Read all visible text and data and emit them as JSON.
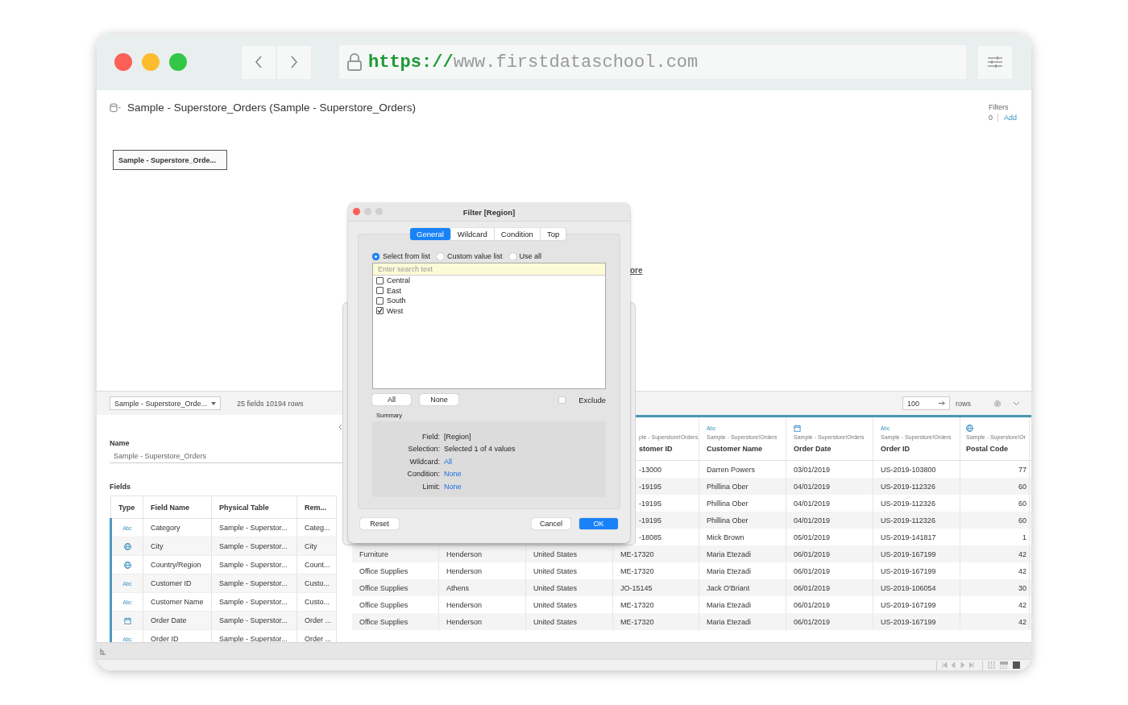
{
  "browser": {
    "url_scheme": "https://",
    "url_host": "www.firstdataschool.com"
  },
  "datasource": {
    "title": "Sample - Superstore_Orders (Sample - Superstore_Orders)",
    "filters_label": "Filters",
    "filters_count": "0",
    "filters_add": "Add",
    "table_chip": "Sample - Superstore_Orde...",
    "link_fragment": "ore"
  },
  "toolbar": {
    "table_select": "Sample - Superstore_Orde...",
    "summary": "25 fields 10194 rows",
    "rows_value": "100",
    "rows_label": "rows"
  },
  "metadata": {
    "name_label": "Name",
    "name_value": "Sample - Superstore_Orders",
    "fields_label": "Fields",
    "columns": [
      "Type",
      "Field Name",
      "Physical Table",
      "Rem..."
    ],
    "rows": [
      {
        "kind": "string",
        "icon_text": "Abc",
        "field": "Category",
        "table": "Sample - Superstor...",
        "remote": "Categ..."
      },
      {
        "kind": "geo",
        "field": "City",
        "table": "Sample - Superstor...",
        "remote": "City"
      },
      {
        "kind": "geo",
        "field": "Country/Region",
        "table": "Sample - Superstor...",
        "remote": "Count..."
      },
      {
        "kind": "string",
        "icon_text": "Abc",
        "field": "Customer ID",
        "table": "Sample - Superstor...",
        "remote": "Custo..."
      },
      {
        "kind": "string",
        "icon_text": "Abc",
        "field": "Customer Name",
        "table": "Sample - Superstor...",
        "remote": "Custo..."
      },
      {
        "kind": "date",
        "field": "Order Date",
        "table": "Sample - Superstor...",
        "remote": "Order ..."
      },
      {
        "kind": "string",
        "icon_text": "Abc",
        "field": "Order ID",
        "table": "Sample - Superstor...",
        "remote": "Order ..."
      }
    ]
  },
  "grid": {
    "columns": [
      {
        "source": "ple - Superstore!Orders",
        "name": "stomer ID"
      },
      {
        "kind": "string",
        "icon_text": "Abc",
        "source": "Sample - Superstore!Orders",
        "name": "Customer Name"
      },
      {
        "kind": "date",
        "source": "Sample - Superstore!Orders",
        "name": "Order Date"
      },
      {
        "kind": "string",
        "icon_text": "Abc",
        "source": "Sample - Superstore!Orders",
        "name": "Order ID"
      },
      {
        "kind": "geo",
        "source": "Sample - Superstore!Or",
        "name": "Postal Code"
      }
    ],
    "rows": [
      {
        "cells": [
          "-13000",
          "Darren Powers",
          "03/01/2019",
          "US-2019-103800",
          "77"
        ]
      },
      {
        "cells": [
          "-19195",
          "Phillina Ober",
          "04/01/2019",
          "US-2019-112326",
          "60"
        ]
      },
      {
        "cells": [
          "-19195",
          "Phillina Ober",
          "04/01/2019",
          "US-2019-112326",
          "60"
        ]
      },
      {
        "cells": [
          "-19195",
          "Phillina Ober",
          "04/01/2019",
          "US-2019-112326",
          "60"
        ]
      },
      {
        "cells": [
          "-18085",
          "Mick Brown",
          "05/01/2019",
          "US-2019-141817",
          "1"
        ]
      },
      {
        "cells": [
          "Furniture",
          "Henderson",
          "United States",
          "ME-17320",
          "Maria Etezadi",
          "06/01/2019",
          "US-2019-167199",
          "42"
        ]
      },
      {
        "cells": [
          "Office Supplies",
          "Henderson",
          "United States",
          "ME-17320",
          "Maria Etezadi",
          "06/01/2019",
          "US-2019-167199",
          "42"
        ]
      },
      {
        "cells": [
          "Office Supplies",
          "Athens",
          "United States",
          "JO-15145",
          "Jack O'Briant",
          "06/01/2019",
          "US-2019-106054",
          "30"
        ]
      },
      {
        "cells": [
          "Office Supplies",
          "Henderson",
          "United States",
          "ME-17320",
          "Maria Etezadi",
          "06/01/2019",
          "US-2019-167199",
          "42"
        ]
      },
      {
        "cells": [
          "Office Supplies",
          "Henderson",
          "United States",
          "ME-17320",
          "Maria Etezadi",
          "06/01/2019",
          "US-2019-167199",
          "42"
        ]
      }
    ]
  },
  "dialog": {
    "title": "Filter [Region]",
    "tabs": [
      {
        "label": "General",
        "selected": true
      },
      {
        "label": "Wildcard",
        "selected": false
      },
      {
        "label": "Condition",
        "selected": false
      },
      {
        "label": "Top",
        "selected": false
      }
    ],
    "modes": [
      {
        "label": "Select from list",
        "selected": true
      },
      {
        "label": "Custom value list",
        "selected": false
      },
      {
        "label": "Use all",
        "selected": false
      }
    ],
    "search_placeholder": "Enter search text",
    "values": [
      {
        "label": "Central",
        "checked": false
      },
      {
        "label": "East",
        "checked": false
      },
      {
        "label": "South",
        "checked": false
      },
      {
        "label": "West",
        "checked": true
      }
    ],
    "all_button": "All",
    "none_button": "None",
    "exclude": {
      "label": "Exclude",
      "checked": false
    },
    "summary_label": "Summary",
    "summary": [
      {
        "label": "Field:",
        "value": "[Region]",
        "kind": "text"
      },
      {
        "label": "Selection:",
        "value": "Selected 1 of 4 values",
        "kind": "text"
      },
      {
        "label": "Wildcard:",
        "value": "All",
        "kind": "link"
      },
      {
        "label": "Condition:",
        "value": "None",
        "kind": "link"
      },
      {
        "label": "Limit:",
        "value": "None",
        "kind": "link"
      }
    ],
    "reset_button": "Reset",
    "cancel_button": "Cancel",
    "ok_button": "OK"
  }
}
